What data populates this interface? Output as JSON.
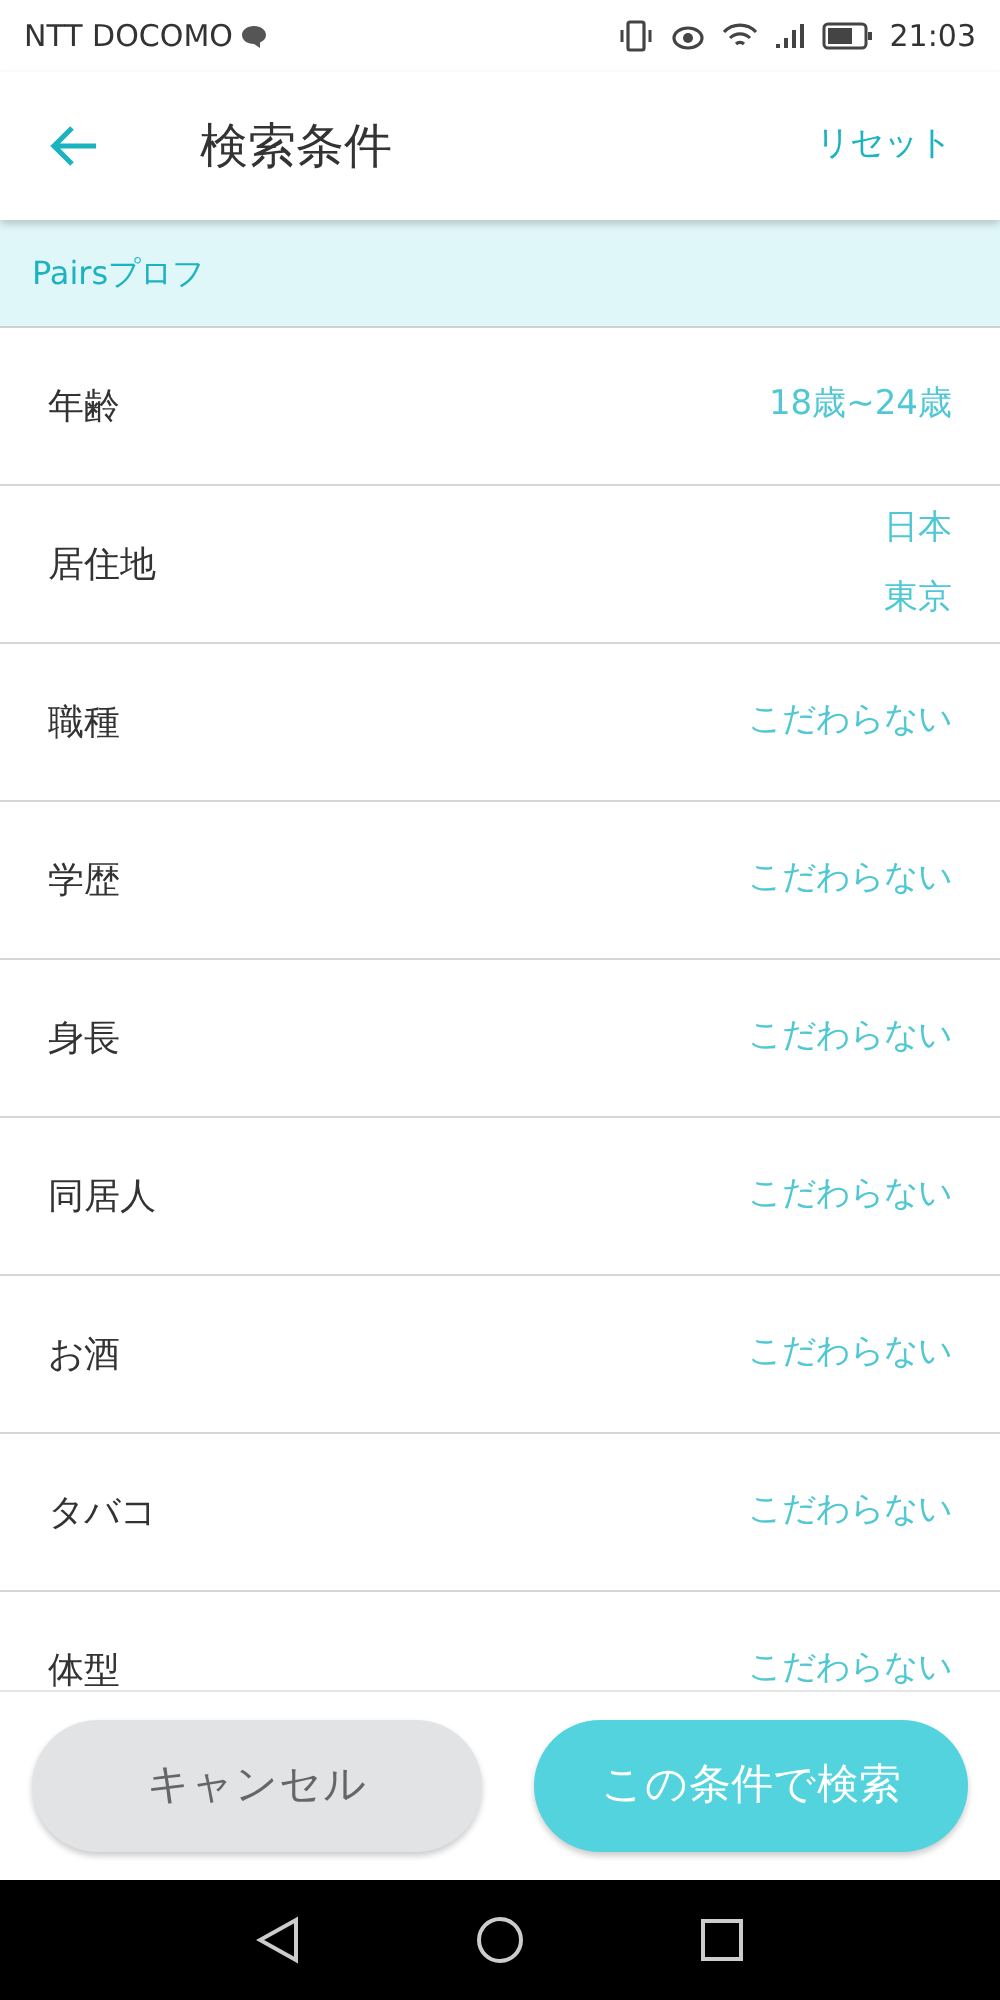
{
  "status_bar": {
    "carrier": "NTT DOCOMO",
    "time": "21:03"
  },
  "header": {
    "title": "検索条件",
    "reset": "リセット"
  },
  "section": {
    "title": "Pairsプロフ"
  },
  "rows": [
    {
      "label": "年齢",
      "values": [
        "18歳~24歳"
      ]
    },
    {
      "label": "居住地",
      "values": [
        "日本",
        "東京"
      ]
    },
    {
      "label": "職種",
      "values": [
        "こだわらない"
      ]
    },
    {
      "label": "学歴",
      "values": [
        "こだわらない"
      ]
    },
    {
      "label": "身長",
      "values": [
        "こだわらない"
      ]
    },
    {
      "label": "同居人",
      "values": [
        "こだわらない"
      ]
    },
    {
      "label": "お酒",
      "values": [
        "こだわらない"
      ]
    },
    {
      "label": "タバコ",
      "values": [
        "こだわらない"
      ]
    },
    {
      "label": "体型",
      "values": [
        "こだわらない"
      ]
    }
  ],
  "buttons": {
    "cancel": "キャンセル",
    "search": "この条件で検索"
  }
}
